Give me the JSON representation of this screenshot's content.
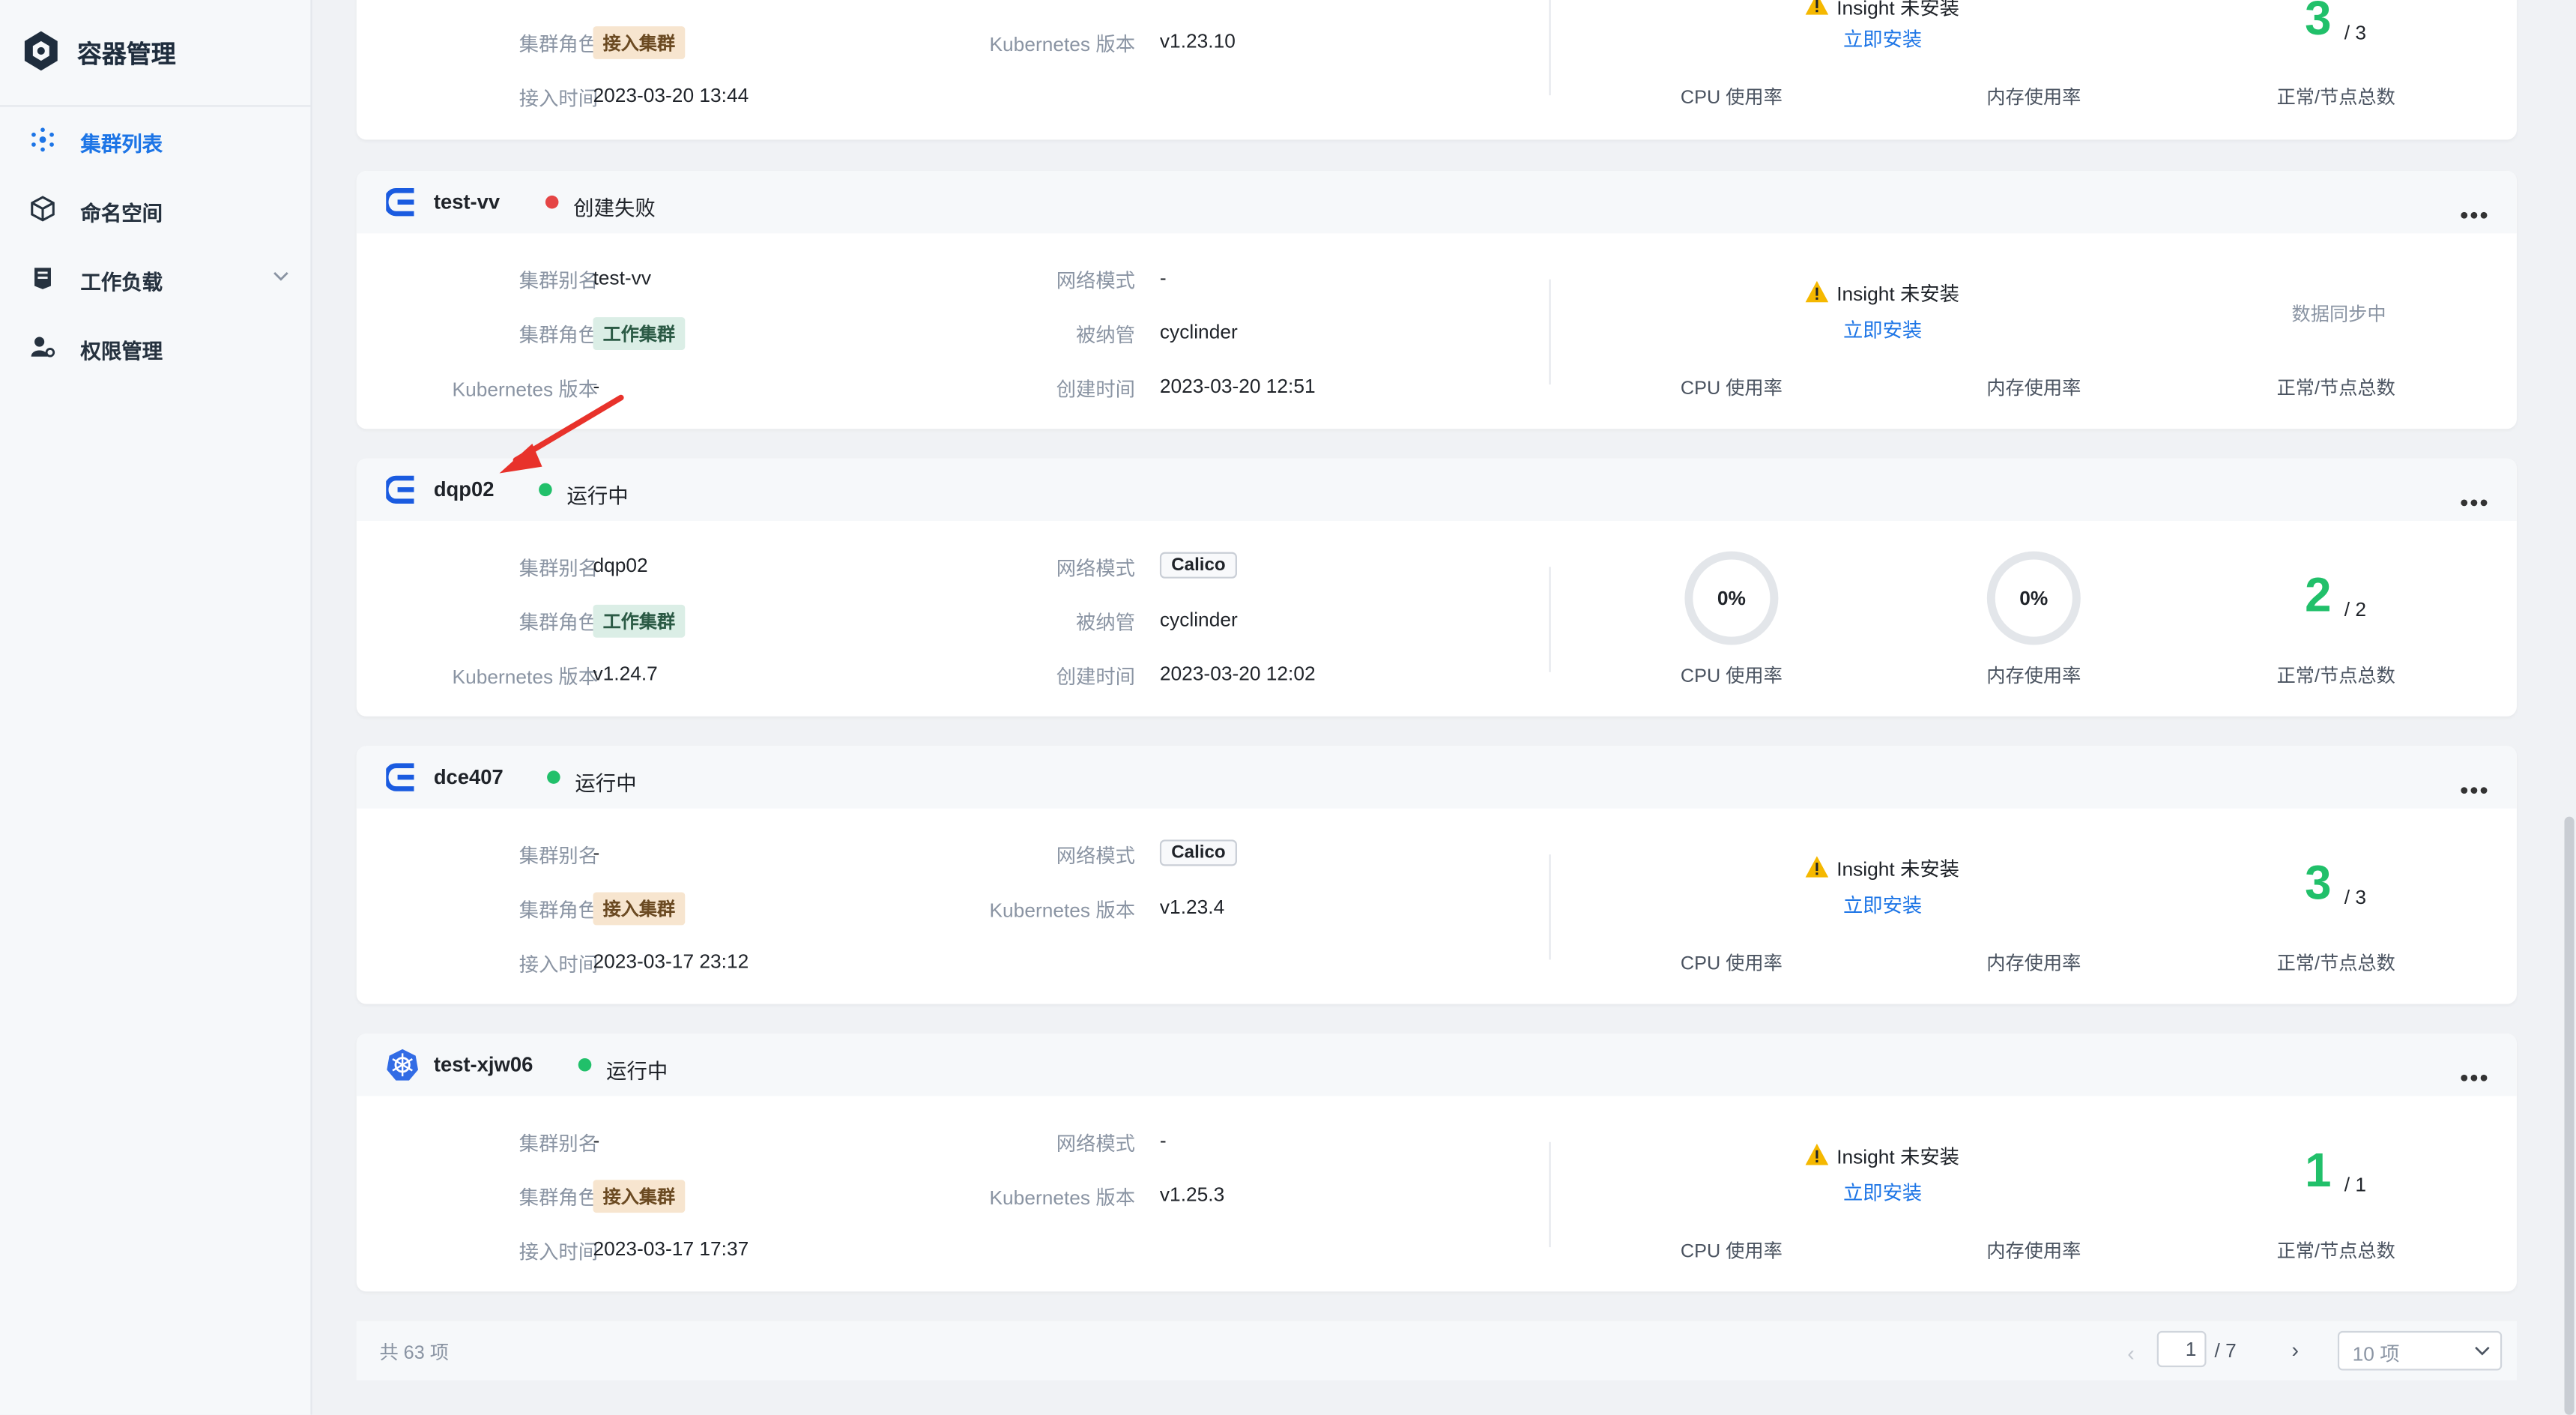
{
  "app": {
    "title": "容器管理"
  },
  "sidebar": {
    "items": [
      {
        "label": "集群列表",
        "icon": "cluster-icon",
        "active": true
      },
      {
        "label": "命名空间",
        "icon": "cube-icon"
      },
      {
        "label": "工作负载",
        "icon": "workload-icon",
        "expandable": true
      },
      {
        "label": "权限管理",
        "icon": "user-key-icon"
      }
    ]
  },
  "labels": {
    "alias": "集群别名",
    "role": "集群角色",
    "k8s_version": "Kubernetes 版本",
    "access_time": "接入时间",
    "network_mode": "网络模式",
    "managed_by": "被纳管",
    "created_time": "创建时间",
    "cpu_usage": "CPU 使用率",
    "mem_usage": "内存使用率",
    "nodes": "正常/节点总数",
    "insight_not_installed": "Insight 未安装",
    "install_now": "立即安装",
    "syncing": "数据同步中"
  },
  "clusters": [
    {
      "name": "",
      "role": "接入集群",
      "k8s_version": "v1.23.10",
      "access_time": "2023-03-20 13:44",
      "nodes_ok": "3",
      "nodes_total": "/ 3"
    },
    {
      "name": "test-vv",
      "status": "创建失败",
      "status_color": "#e54545",
      "alias": "test-vv",
      "role": "工作集群",
      "k8s_version": "-",
      "network_mode": "-",
      "managed_by": "cyclinder",
      "created_time": "2023-03-20 12:51"
    },
    {
      "name": "dqp02",
      "status": "运行中",
      "status_color": "#21c06a",
      "alias": "dqp02",
      "role": "工作集群",
      "k8s_version": "v1.24.7",
      "network_mode": "Calico",
      "managed_by": "cyclinder",
      "created_time": "2023-03-20 12:02",
      "cpu": "0%",
      "mem": "0%",
      "nodes_ok": "2",
      "nodes_total": "/ 2"
    },
    {
      "name": "dce407",
      "status": "运行中",
      "status_color": "#21c06a",
      "alias": "-",
      "role": "接入集群",
      "network_mode": "Calico",
      "k8s_version": "v1.23.4",
      "access_time": "2023-03-17 23:12",
      "nodes_ok": "3",
      "nodes_total": "/ 3"
    },
    {
      "name": "test-xjw06",
      "status": "运行中",
      "status_color": "#21c06a",
      "alias": "-",
      "role": "接入集群",
      "network_mode": "-",
      "k8s_version": "v1.25.3",
      "access_time": "2023-03-17 17:37",
      "nodes_ok": "1",
      "nodes_total": "/ 1"
    }
  ],
  "pagination": {
    "total": "共 63 项",
    "current_page": "1",
    "of_pages": "/ 7",
    "page_size": "10 项"
  },
  "colors": {
    "accent": "#1d75e6",
    "success": "#21c06a",
    "error": "#e54545"
  }
}
